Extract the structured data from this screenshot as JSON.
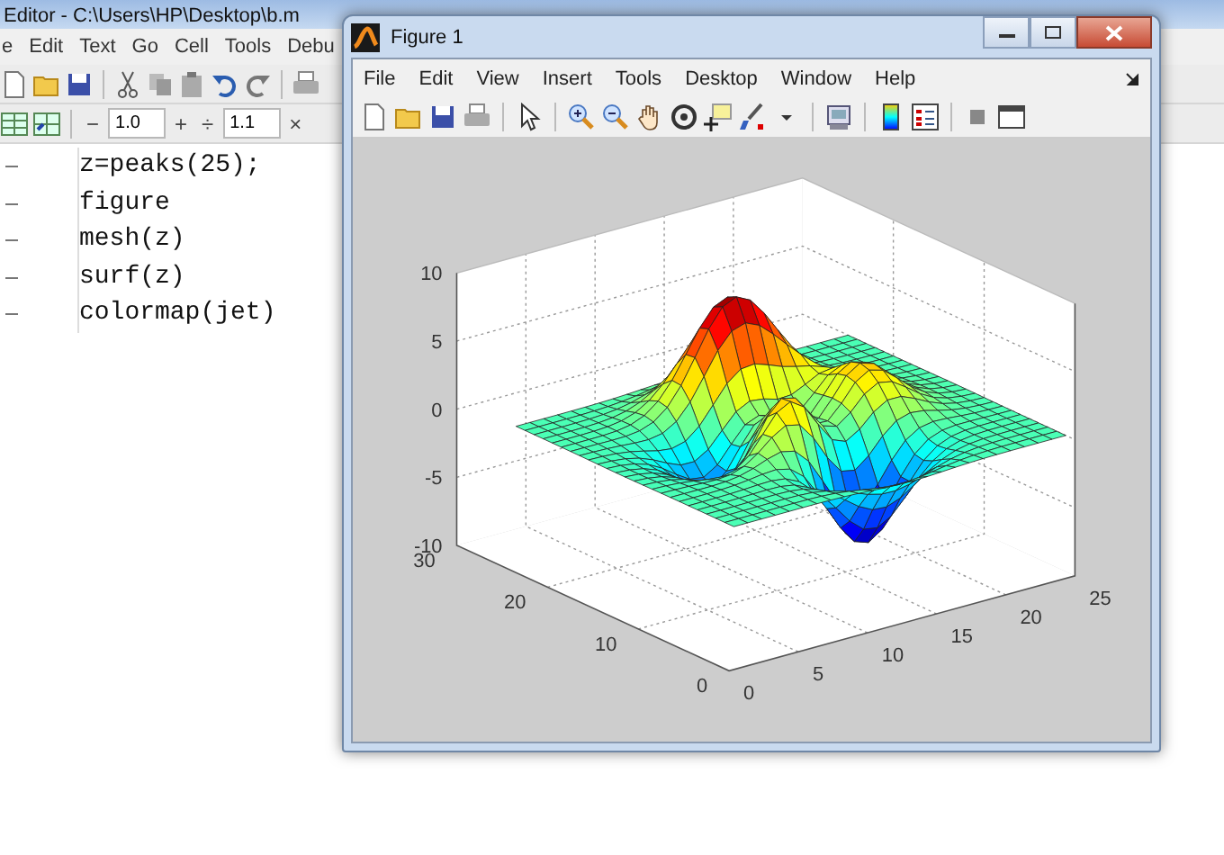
{
  "editor": {
    "title": "Editor - C:\\Users\\HP\\Desktop\\b.m",
    "menu": [
      "e",
      "Edit",
      "Text",
      "Go",
      "Cell",
      "Tools",
      "Debu"
    ],
    "zoom_controls": [
      {
        "kind": "button",
        "text": "−"
      },
      {
        "kind": "field",
        "value": "1.0"
      },
      {
        "kind": "button",
        "text": "+"
      },
      {
        "kind": "button",
        "text": "÷"
      },
      {
        "kind": "field",
        "value": "1.1"
      },
      {
        "kind": "button",
        "text": "×"
      }
    ],
    "code_lines": [
      "z=peaks(25);",
      "figure",
      "mesh(z)",
      "surf(z)",
      "colormap(jet)"
    ]
  },
  "figure": {
    "title": "Figure 1",
    "menu": [
      "File",
      "Edit",
      "View",
      "Insert",
      "Tools",
      "Desktop",
      "Window",
      "Help"
    ],
    "plot": {
      "z_ticks": [
        "10",
        "5",
        "0",
        "-5",
        "-10"
      ],
      "y_ticks": [
        "0",
        "10",
        "20",
        "30"
      ],
      "x_ticks": [
        "0",
        "5",
        "10",
        "15",
        "20",
        "25"
      ]
    }
  }
}
